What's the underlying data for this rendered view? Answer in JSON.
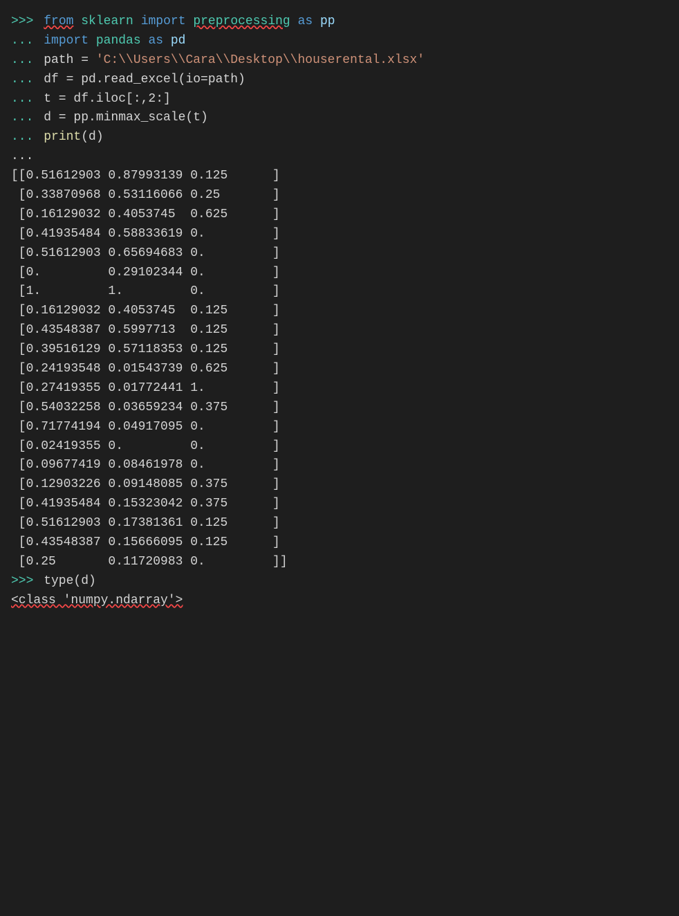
{
  "terminal": {
    "lines": [
      {
        "type": "input",
        "prompt": ">>>",
        "tokens": [
          {
            "text": " ",
            "class": "plain"
          },
          {
            "text": "from",
            "class": "kw-from underline-red"
          },
          {
            "text": " ",
            "class": "plain"
          },
          {
            "text": "sklearn",
            "class": "module-name"
          },
          {
            "text": " ",
            "class": "plain"
          },
          {
            "text": "import",
            "class": "kw-import"
          },
          {
            "text": " ",
            "class": "plain"
          },
          {
            "text": "preprocessing",
            "class": "module-name underline-red"
          },
          {
            "text": " ",
            "class": "plain"
          },
          {
            "text": "as",
            "class": "kw-as"
          },
          {
            "text": " ",
            "class": "plain"
          },
          {
            "text": "pp",
            "class": "alias"
          }
        ]
      },
      {
        "type": "input",
        "prompt": "...",
        "tokens": [
          {
            "text": " ",
            "class": "plain"
          },
          {
            "text": "import",
            "class": "kw-import"
          },
          {
            "text": " ",
            "class": "plain"
          },
          {
            "text": "pandas",
            "class": "module-name"
          },
          {
            "text": " ",
            "class": "plain"
          },
          {
            "text": "as",
            "class": "kw-as"
          },
          {
            "text": " pd",
            "class": "alias"
          }
        ]
      },
      {
        "type": "input",
        "prompt": "...",
        "tokens": [
          {
            "text": " path = ",
            "class": "plain"
          },
          {
            "text": "'C:\\\\Users\\\\Cara\\\\Desktop\\\\houserental.xlsx'",
            "class": "string-val"
          }
        ]
      },
      {
        "type": "input",
        "prompt": "...",
        "tokens": [
          {
            "text": " df = pd.read_excel(io=path)",
            "class": "plain"
          }
        ]
      },
      {
        "type": "input",
        "prompt": "...",
        "tokens": [
          {
            "text": " t = df.iloc[:,2:]",
            "class": "plain"
          }
        ]
      },
      {
        "type": "input",
        "prompt": "...",
        "tokens": [
          {
            "text": " d = pp.minmax_scale(t)",
            "class": "plain"
          }
        ]
      },
      {
        "type": "input",
        "prompt": "...",
        "tokens": [
          {
            "text": " ",
            "class": "plain"
          },
          {
            "text": "print",
            "class": "kw-print"
          },
          {
            "text": "(d)",
            "class": "plain"
          }
        ]
      },
      {
        "type": "output",
        "text": "..."
      },
      {
        "type": "output",
        "text": "[[0.51612903 0.87993139 0.125      ]"
      },
      {
        "type": "output",
        "text": " [0.33870968 0.53116066 0.25       ]"
      },
      {
        "type": "output",
        "text": " [0.16129032 0.4053745  0.625      ]"
      },
      {
        "type": "output",
        "text": " [0.41935484 0.58833619 0.         ]"
      },
      {
        "type": "output",
        "text": " [0.51612903 0.65694683 0.         ]"
      },
      {
        "type": "output",
        "text": " [0.         0.29102344 0.         ]"
      },
      {
        "type": "output",
        "text": " [1.         1.         0.         ]"
      },
      {
        "type": "output",
        "text": " [0.16129032 0.4053745  0.125      ]"
      },
      {
        "type": "output",
        "text": " [0.43548387 0.5997713  0.125      ]"
      },
      {
        "type": "output",
        "text": " [0.39516129 0.57118353 0.125      ]"
      },
      {
        "type": "output",
        "text": " [0.24193548 0.01543739 0.625      ]"
      },
      {
        "type": "output",
        "text": " [0.27419355 0.01772441 1.         ]"
      },
      {
        "type": "output",
        "text": " [0.54032258 0.03659234 0.375      ]"
      },
      {
        "type": "output",
        "text": " [0.71774194 0.04917095 0.         ]"
      },
      {
        "type": "output",
        "text": " [0.02419355 0.         0.         ]"
      },
      {
        "type": "output",
        "text": " [0.09677419 0.08461978 0.         ]"
      },
      {
        "type": "output",
        "text": " [0.12903226 0.09148085 0.375      ]"
      },
      {
        "type": "output",
        "text": " [0.41935484 0.15323042 0.375      ]"
      },
      {
        "type": "output",
        "text": " [0.51612903 0.17381361 0.125      ]"
      },
      {
        "type": "output",
        "text": " [0.43548387 0.15666095 0.125      ]"
      },
      {
        "type": "output",
        "text": " [0.25       0.11720983 0.         ]]"
      },
      {
        "type": "input",
        "prompt": ">>>",
        "tokens": [
          {
            "text": " type(d)",
            "class": "plain"
          }
        ]
      },
      {
        "type": "class-output",
        "text": "<class 'numpy.ndarray'>"
      }
    ]
  }
}
